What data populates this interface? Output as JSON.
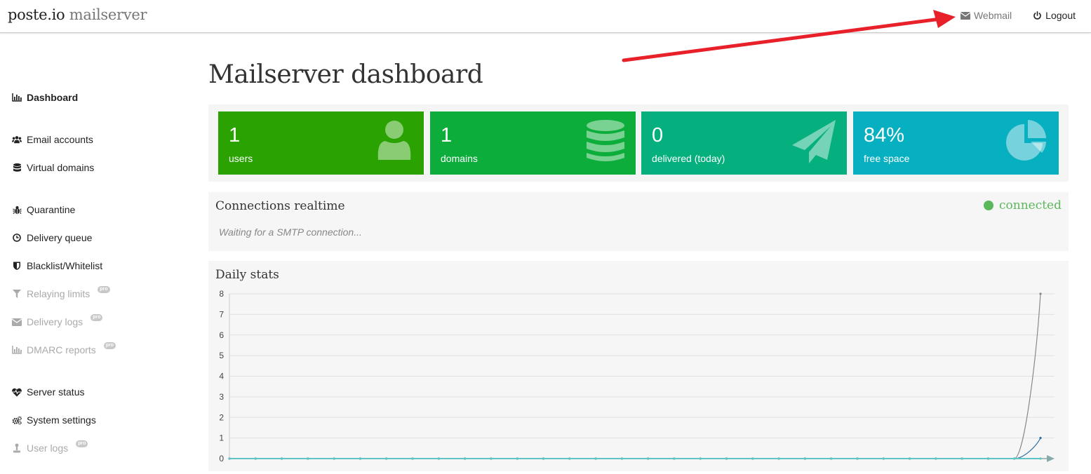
{
  "brand": {
    "part1": "poste.io",
    "part2": "mailserver"
  },
  "nav": {
    "webmail": "Webmail",
    "logout": "Logout"
  },
  "sidebar": {
    "items": [
      {
        "label": "Dashboard",
        "icon": "bar-chart-icon"
      },
      {
        "label": "Email accounts",
        "icon": "users-icon"
      },
      {
        "label": "Virtual domains",
        "icon": "database-icon"
      },
      {
        "label": "Quarantine",
        "icon": "bug-icon"
      },
      {
        "label": "Delivery queue",
        "icon": "clock-icon"
      },
      {
        "label": "Blacklist/Whitelist",
        "icon": "shield-icon"
      },
      {
        "label": "Relaying limits",
        "icon": "filter-icon",
        "pro": "pro"
      },
      {
        "label": "Delivery logs",
        "icon": "envelope-icon",
        "pro": "pro"
      },
      {
        "label": "DMARC reports",
        "icon": "bar-chart-icon",
        "pro": "pro"
      },
      {
        "label": "Server status",
        "icon": "heartbeat-icon"
      },
      {
        "label": "System settings",
        "icon": "cogs-icon"
      },
      {
        "label": "User logs",
        "icon": "user-log-icon",
        "pro": "pro"
      }
    ]
  },
  "main": {
    "title": "Mailserver dashboard",
    "stats": [
      {
        "value": "1",
        "label": "users",
        "color": "#2aa302",
        "icon": "user-icon"
      },
      {
        "value": "1",
        "label": "domains",
        "color": "#0cad3a",
        "icon": "database-icon"
      },
      {
        "value": "0",
        "label": "delivered (today)",
        "color": "#05b07e",
        "icon": "paper-plane-icon"
      },
      {
        "value": "84%",
        "label": "free space",
        "color": "#07b0c1",
        "icon": "pie-chart-icon"
      }
    ],
    "connections": {
      "title": "Connections realtime",
      "status": "connected",
      "status_color": "#5cb85c",
      "waiting": "Waiting for a SMTP connection..."
    },
    "daily": {
      "title": "Daily stats"
    }
  },
  "chart_data": {
    "type": "line",
    "title": "",
    "xlabel": "",
    "ylabel": "",
    "ylim": [
      0,
      8
    ],
    "yticks": [
      0,
      1,
      2,
      3,
      4,
      5,
      6,
      7,
      8
    ],
    "grid": true,
    "x": [
      1,
      2,
      3,
      4,
      5,
      6,
      7,
      8,
      9,
      10,
      11,
      12,
      13,
      14,
      15,
      16,
      17,
      18,
      19,
      20,
      21,
      22,
      23,
      24,
      25,
      26,
      27,
      28,
      29,
      30,
      31,
      32
    ],
    "series": [
      {
        "color": "#888888",
        "values": [
          0,
          0,
          0,
          0,
          0,
          0,
          0,
          0,
          0,
          0,
          0,
          0,
          0,
          0,
          0,
          0,
          0,
          0,
          0,
          0,
          0,
          0,
          0,
          0,
          0,
          0,
          0,
          0,
          0,
          0,
          0,
          8
        ]
      },
      {
        "color": "#2e6da4",
        "values": [
          0,
          0,
          0,
          0,
          0,
          0,
          0,
          0,
          0,
          0,
          0,
          0,
          0,
          0,
          0,
          0,
          0,
          0,
          0,
          0,
          0,
          0,
          0,
          0,
          0,
          0,
          0,
          0,
          0,
          0,
          0,
          1
        ]
      },
      {
        "color": "#5ec4c4",
        "values": [
          0,
          0,
          0,
          0,
          0,
          0,
          0,
          0,
          0,
          0,
          0,
          0,
          0,
          0,
          0,
          0,
          0,
          0,
          0,
          0,
          0,
          0,
          0,
          0,
          0,
          0,
          0,
          0,
          0,
          0,
          0,
          0
        ]
      }
    ]
  }
}
